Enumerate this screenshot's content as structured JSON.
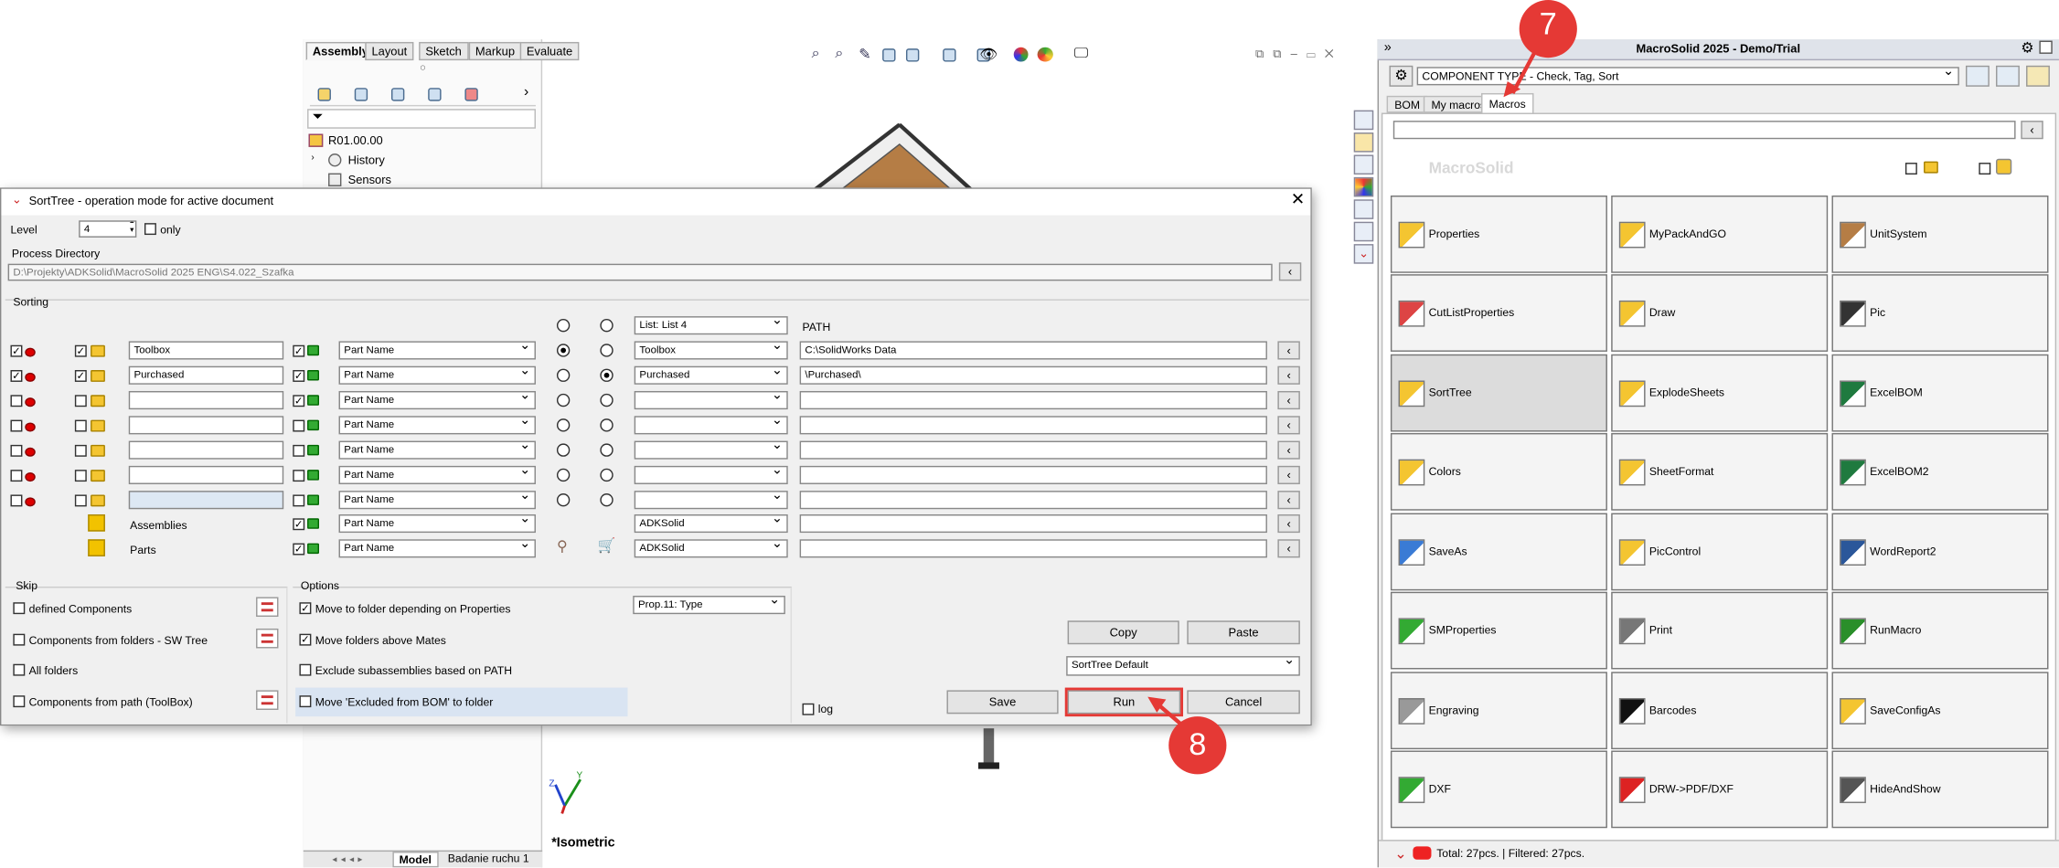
{
  "sw": {
    "tabs": [
      "Assembly",
      "Layout",
      "Sketch",
      "Markup",
      "Evaluate"
    ],
    "tree": {
      "root": "R01.00.00",
      "items": [
        "History",
        "Sensors"
      ]
    },
    "view_label": "*Isometric",
    "bottom_tabs": [
      "Model",
      "Badanie ruchu 1"
    ]
  },
  "macrosolid": {
    "title": "MacroSolid 2025 - Demo/Trial",
    "selector": "COMPONENT TYPE - Check, Tag, Sort",
    "tabs": [
      "BOM",
      "My macros",
      "Macros"
    ],
    "logo": "MacroSolid",
    "macros": [
      {
        "label": "Properties",
        "icon": "properties-icon"
      },
      {
        "label": "MyPackAndGO",
        "icon": "pack-and-go-icon"
      },
      {
        "label": "UnitSystem",
        "icon": "unit-system-icon"
      },
      {
        "label": "CutListProperties",
        "icon": "cutlist-icon"
      },
      {
        "label": "Draw",
        "icon": "draw-icon"
      },
      {
        "label": "Pic",
        "icon": "camera-icon"
      },
      {
        "label": "SortTree",
        "icon": "sort-tree-icon"
      },
      {
        "label": "ExplodeSheets",
        "icon": "explode-sheets-icon"
      },
      {
        "label": "ExcelBOM",
        "icon": "excel-icon"
      },
      {
        "label": "Colors",
        "icon": "colors-ral-icon"
      },
      {
        "label": "SheetFormat",
        "icon": "sheet-format-icon"
      },
      {
        "label": "ExcelBOM2",
        "icon": "excel-icon"
      },
      {
        "label": "SaveAs",
        "icon": "save-as-icon"
      },
      {
        "label": "PicControl",
        "icon": "pic-control-icon"
      },
      {
        "label": "WordReport2",
        "icon": "word-icon"
      },
      {
        "label": "SMProperties",
        "icon": "sheet-metal-icon"
      },
      {
        "label": "Print",
        "icon": "printer-icon"
      },
      {
        "label": "RunMacro",
        "icon": "run-macro-icon"
      },
      {
        "label": "Engraving",
        "icon": "engraving-icon"
      },
      {
        "label": "Barcodes",
        "icon": "qr-code-icon"
      },
      {
        "label": "SaveConfigAs",
        "icon": "save-config-icon"
      },
      {
        "label": "DXF",
        "icon": "dxf-icon"
      },
      {
        "label": "DRW->PDF/DXF",
        "icon": "pdf-icon"
      },
      {
        "label": "HideAndShow",
        "icon": "eye-icon"
      }
    ],
    "status": "Total: 27pcs. | Filtered: 27pcs."
  },
  "dialog": {
    "title": "SortTree - operation mode for active document",
    "level_label": "Level",
    "level_value": "4",
    "only_label": "only",
    "process_dir_label": "Process Directory",
    "process_dir_value": "D:\\Projekty\\ADKSolid\\MacroSolid 2025 ENG\\S4.022_Szafka",
    "sorting_label": "Sorting",
    "list_header": "List: List 4",
    "path_header": "PATH",
    "rows": [
      {
        "a": true,
        "b": true,
        "name": "Toolbox",
        "c": true,
        "prop": "Part Name",
        "r1": true,
        "r2": false,
        "list": "Toolbox",
        "path": "C:\\SolidWorks Data"
      },
      {
        "a": true,
        "b": true,
        "name": "Purchased",
        "c": true,
        "prop": "Part Name",
        "r1": false,
        "r2": true,
        "list": "Purchased",
        "path": "\\Purchased\\"
      },
      {
        "a": false,
        "b": false,
        "name": "",
        "c": true,
        "prop": "Part Name",
        "r1": false,
        "r2": false,
        "list": "",
        "path": ""
      },
      {
        "a": false,
        "b": false,
        "name": "",
        "c": false,
        "prop": "Part Name",
        "r1": false,
        "r2": false,
        "list": "",
        "path": ""
      },
      {
        "a": false,
        "b": false,
        "name": "",
        "c": false,
        "prop": "Part Name",
        "r1": false,
        "r2": false,
        "list": "",
        "path": ""
      },
      {
        "a": false,
        "b": false,
        "name": "",
        "c": false,
        "prop": "Part Name",
        "r1": false,
        "r2": false,
        "list": "",
        "path": ""
      },
      {
        "a": false,
        "b": false,
        "name": "",
        "c": false,
        "prop": "Part Name",
        "r1": false,
        "r2": false,
        "list": "",
        "path": ""
      }
    ],
    "assemblies_label": "Assemblies",
    "parts_label": "Parts",
    "assemblies_prop": "Part Name",
    "parts_prop": "Part Name",
    "assemblies_list": "ADKSolid",
    "parts_list": "ADKSolid",
    "skip_label": "Skip",
    "skip": [
      "defined Components",
      "Components from folders - SW Tree",
      "All folders",
      "Components from path (ToolBox)"
    ],
    "options_label": "Options",
    "options": [
      {
        "label": "Move to folder depending on Properties",
        "checked": true
      },
      {
        "label": "Move folders above Mates",
        "checked": true
      },
      {
        "label": "Exclude subassemblies based on PATH",
        "checked": false
      },
      {
        "label": "Move 'Excluded from BOM' to folder",
        "checked": false
      }
    ],
    "prop_select": "Prop.11: Type",
    "copy": "Copy",
    "paste": "Paste",
    "preset": "SortTree Default",
    "log": "log",
    "save": "Save",
    "run": "Run",
    "cancel": "Cancel"
  },
  "callouts": [
    "7",
    "8"
  ]
}
